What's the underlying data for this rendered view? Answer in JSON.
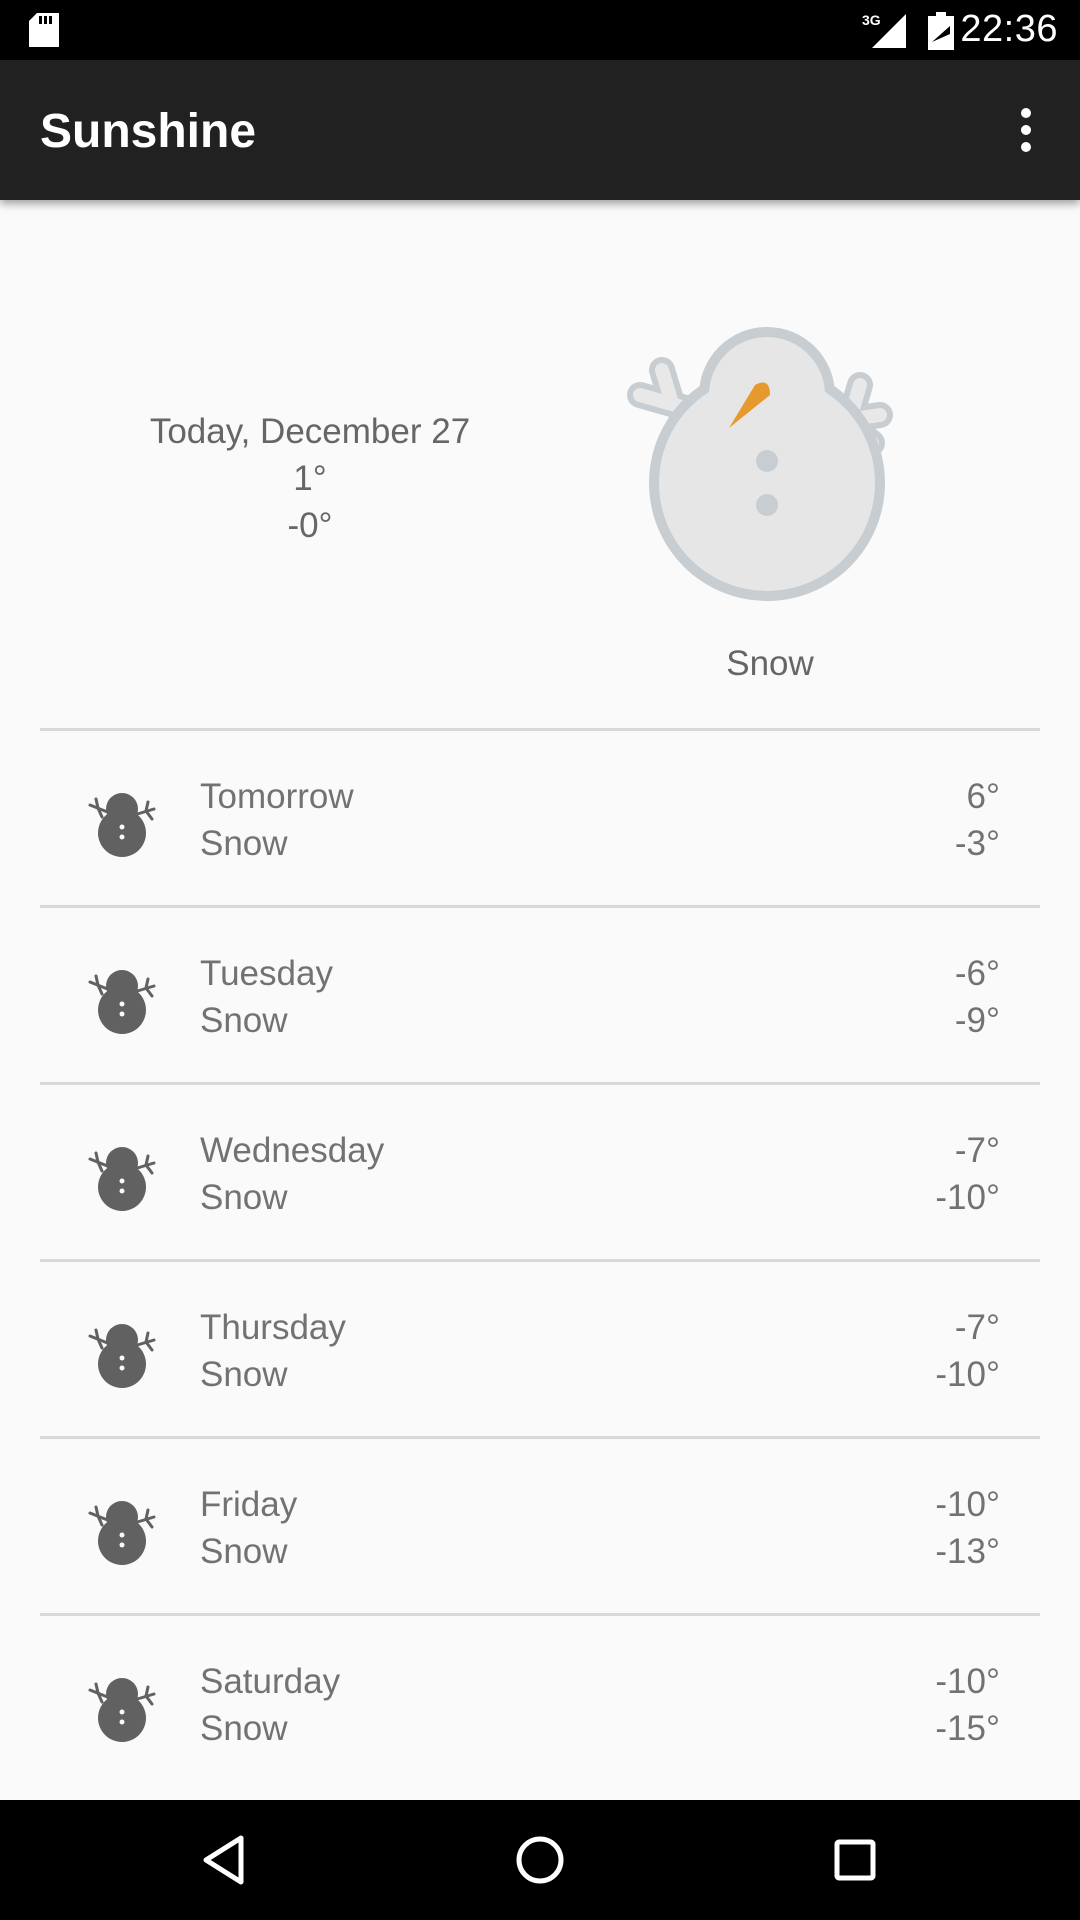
{
  "status_bar": {
    "time": "22:36",
    "network": "3G"
  },
  "app_bar": {
    "title": "Sunshine"
  },
  "today": {
    "date": "Today, December 27",
    "high": "1°",
    "low": "-0°",
    "condition": "Snow",
    "icon": "snowman-icon"
  },
  "forecast": [
    {
      "day": "Tomorrow",
      "condition": "Snow",
      "high": "6°",
      "low": "-3°",
      "icon": "snowman-icon"
    },
    {
      "day": "Tuesday",
      "condition": "Snow",
      "high": "-6°",
      "low": "-9°",
      "icon": "snowman-icon"
    },
    {
      "day": "Wednesday",
      "condition": "Snow",
      "high": "-7°",
      "low": "-10°",
      "icon": "snowman-icon"
    },
    {
      "day": "Thursday",
      "condition": "Snow",
      "high": "-7°",
      "low": "-10°",
      "icon": "snowman-icon"
    },
    {
      "day": "Friday",
      "condition": "Snow",
      "high": "-10°",
      "low": "-13°",
      "icon": "snowman-icon"
    },
    {
      "day": "Saturday",
      "condition": "Snow",
      "high": "-10°",
      "low": "-15°",
      "icon": "snowman-icon"
    }
  ],
  "colors": {
    "app_bar": "#212121",
    "text": "#727272",
    "snowman_fill": "#e6e6e6",
    "snowman_outline": "#c7cdd1",
    "carrot": "#e69a2e",
    "small_icon": "#616161"
  }
}
